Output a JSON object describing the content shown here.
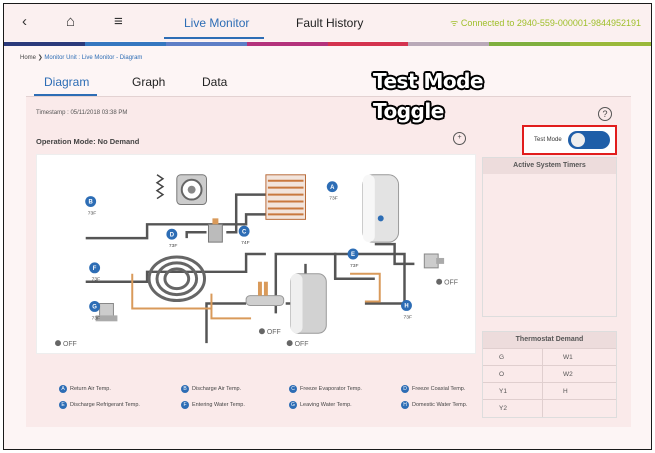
{
  "nav": {
    "back": "‹",
    "home": "⌂",
    "menu": "≡",
    "tabs": [
      "Live Monitor",
      "Fault History"
    ],
    "connection": "Connected to 2940-559-000001-9844952191"
  },
  "colors": [
    "#2b3a7b",
    "#3577c0",
    "#5e7ec6",
    "#b4327c",
    "#d4334f",
    "#b9a9b8",
    "#7faf3e",
    "#9ab93a"
  ],
  "breadcrumb": {
    "home": "Home",
    "sep": "❯",
    "path": "Monitor Unit : Live Monitor - Diagram"
  },
  "subtabs": [
    "Diagram",
    "Graph",
    "Data"
  ],
  "timestamp": "Timestamp : 05/11/2018 03:38 PM",
  "operation_mode": "Operation Mode: No Demand",
  "help": "?",
  "zoom": "🔍",
  "overlay": {
    "line1": "Test Mode",
    "line2": "Toggle"
  },
  "test_mode": {
    "label": "Test Mode",
    "enabled": true
  },
  "diagram": {
    "sensors": [
      {
        "id": "A",
        "value": "73F"
      },
      {
        "id": "B",
        "value": "73F"
      },
      {
        "id": "C",
        "value": "74F"
      },
      {
        "id": "D",
        "value": "73F"
      },
      {
        "id": "E",
        "value": "73F"
      },
      {
        "id": "F",
        "value": "73F"
      },
      {
        "id": "G",
        "value": "73F"
      },
      {
        "id": "H",
        "value": "73F"
      }
    ],
    "off_labels": [
      "OFF",
      "OFF",
      "OFF",
      "OFF"
    ]
  },
  "active_timers": {
    "title": "Active System Timers"
  },
  "thermostat": {
    "title": "Thermostat Demand",
    "rows": [
      [
        "G",
        "W1"
      ],
      [
        "O",
        "W2"
      ],
      [
        "Y1",
        "H"
      ],
      [
        "Y2",
        ""
      ]
    ]
  },
  "legend": [
    {
      "id": "A",
      "label": "Return Air Temp."
    },
    {
      "id": "B",
      "label": "Discharge Air Temp."
    },
    {
      "id": "C",
      "label": "Freeze Evaporator Temp."
    },
    {
      "id": "D",
      "label": "Freeze Coaxial Temp."
    },
    {
      "id": "E",
      "label": "Discharge Refrigerant Temp."
    },
    {
      "id": "F",
      "label": "Entering Water Temp."
    },
    {
      "id": "G",
      "label": "Leaving Water Temp."
    },
    {
      "id": "H",
      "label": "Domestic Water Temp."
    }
  ]
}
